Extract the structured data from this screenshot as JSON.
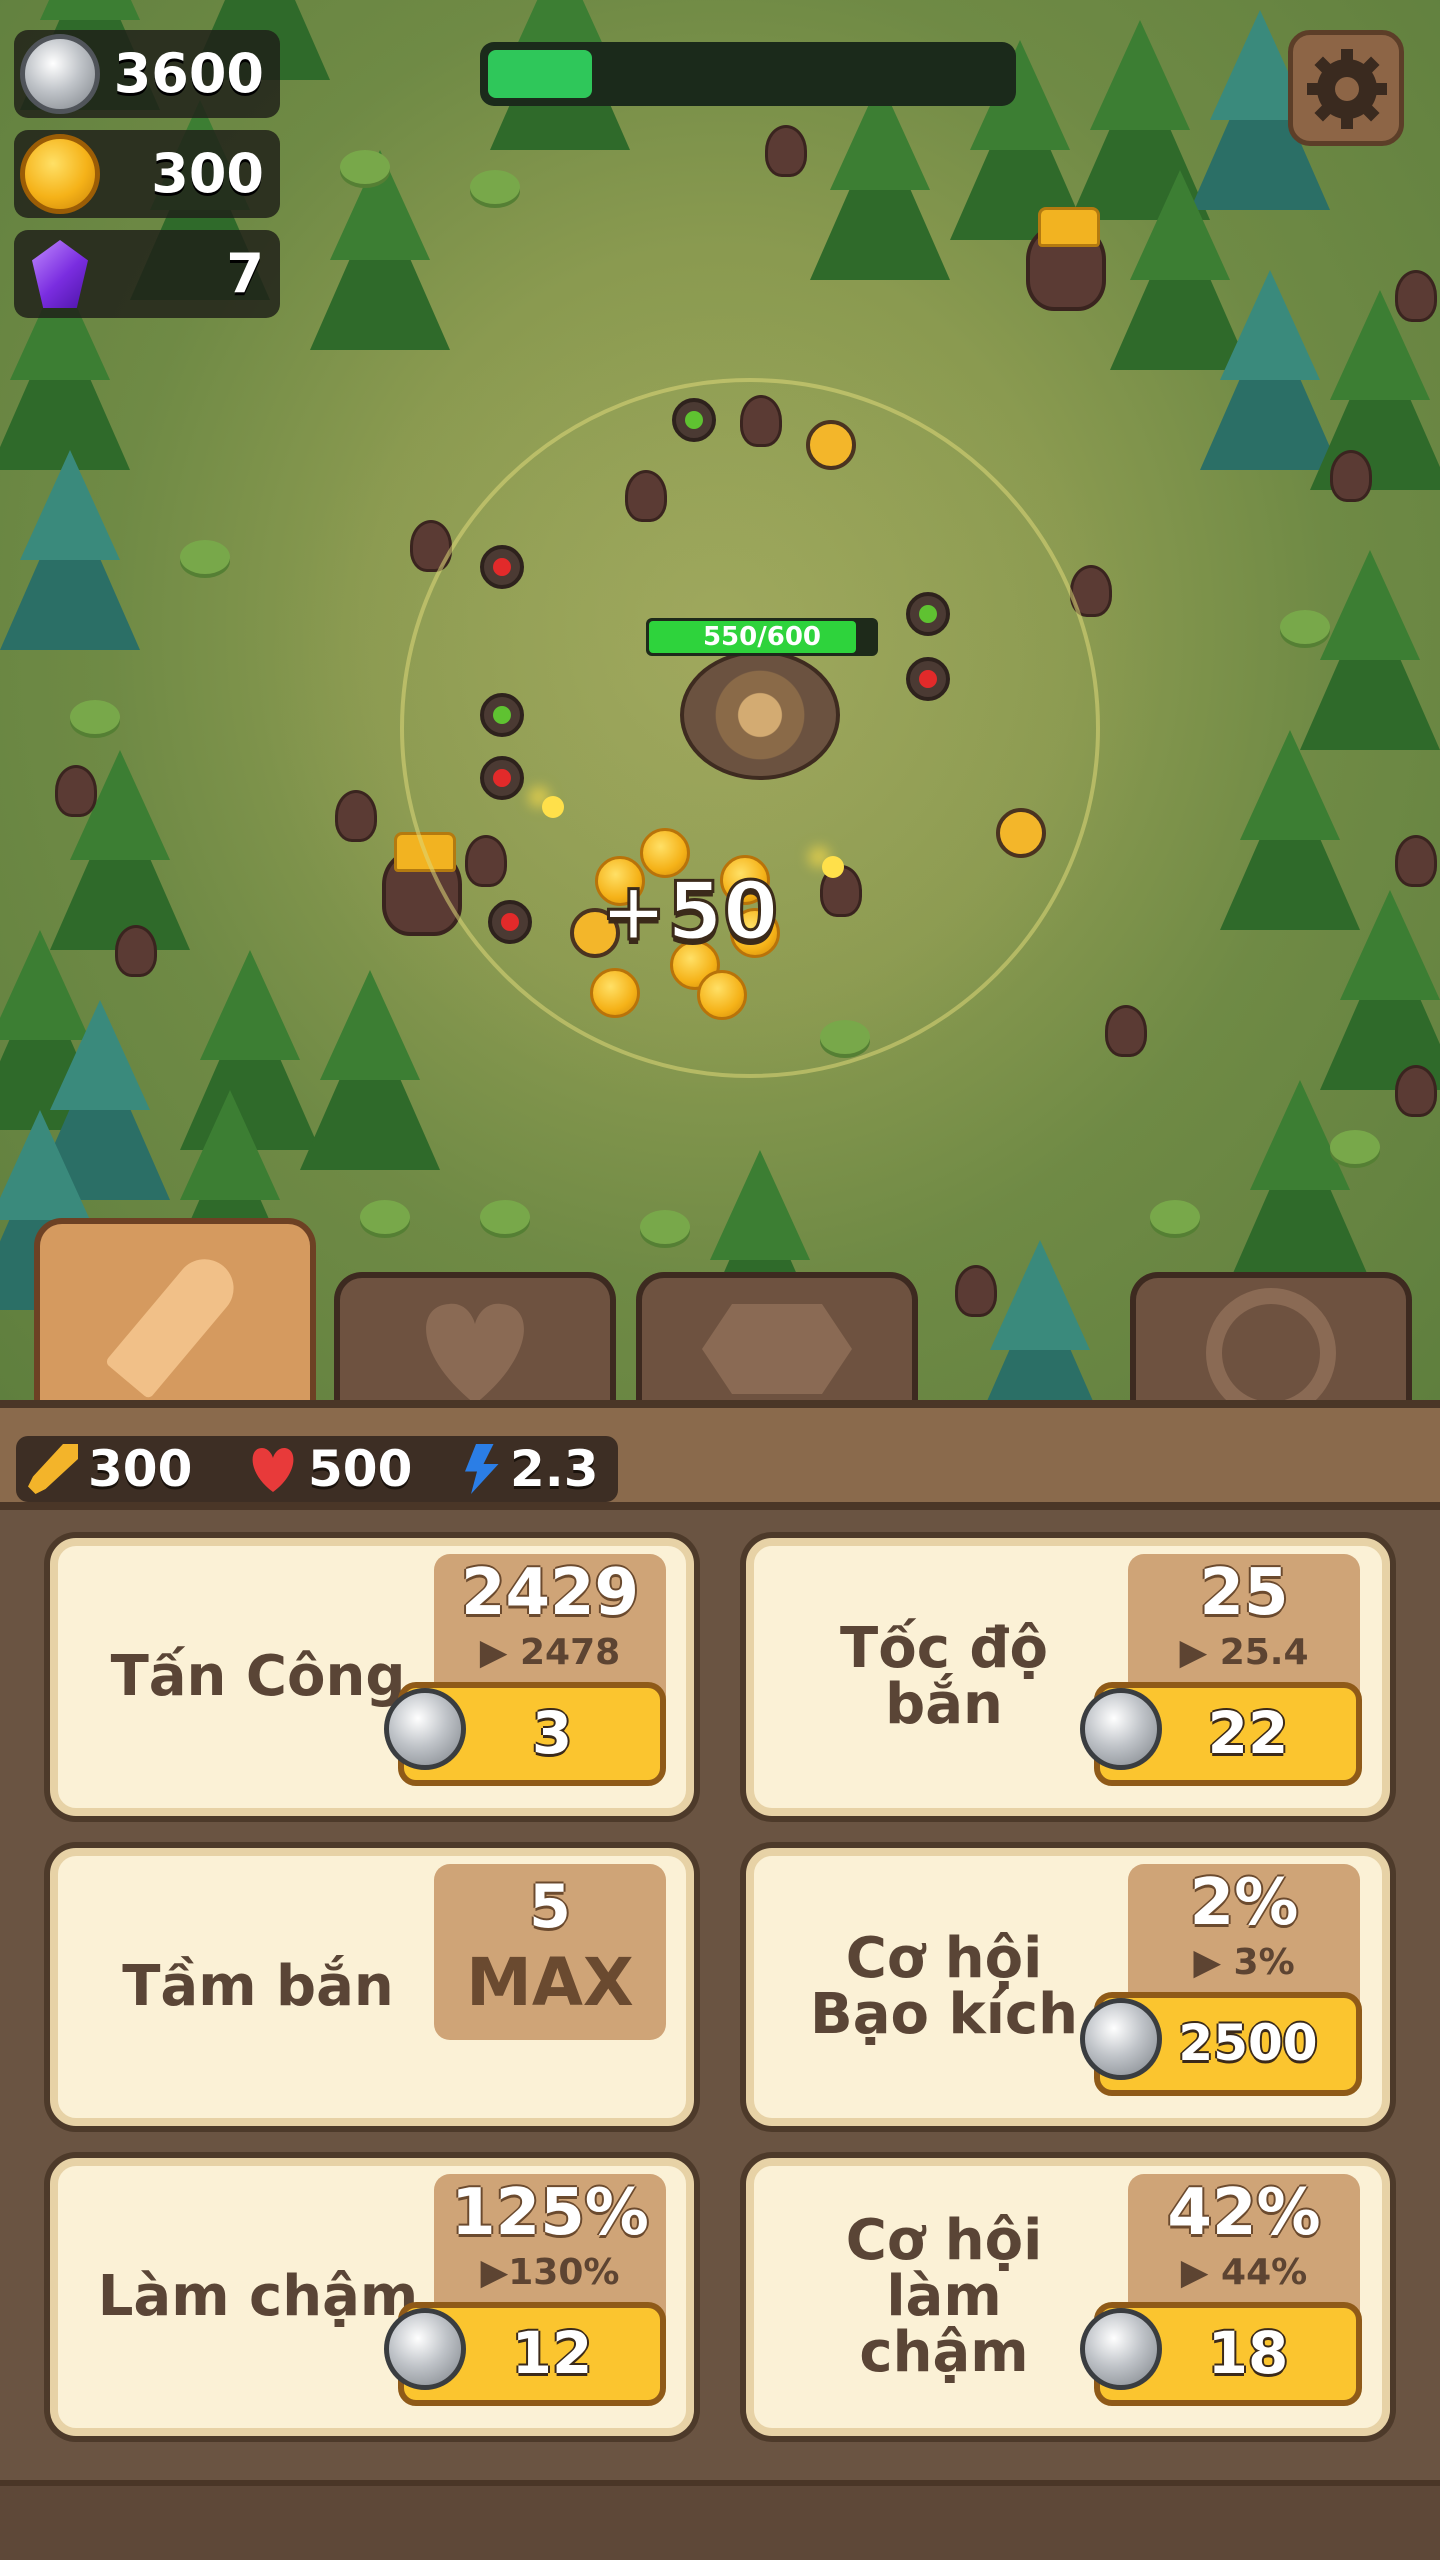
{
  "resources": {
    "silver": "3600",
    "gold": "300",
    "gems": "7"
  },
  "wave_progress": 0.2,
  "tower": {
    "hp_text": "550/600"
  },
  "floating_text": "+50",
  "tabs": [
    {
      "icon": "sword-icon",
      "active": true
    },
    {
      "icon": "heart-icon",
      "active": false
    },
    {
      "icon": "diamond-icon",
      "active": false
    },
    {
      "icon": "target-icon",
      "active": false
    }
  ],
  "stats": {
    "attack": "300",
    "health": "500",
    "speed": "2.3"
  },
  "upgrades": [
    {
      "label": "Tấn Công",
      "current": "2429",
      "next": "▶ 2478",
      "cost": "3"
    },
    {
      "label": "Tốc độ bắn",
      "current": "25",
      "next": "▶ 25.4",
      "cost": "22"
    },
    {
      "label": "Tầm bắn",
      "current": "5",
      "max_label": "MAX"
    },
    {
      "label": "Cơ hội Bạo kích",
      "current": "2%",
      "next": "▶ 3%",
      "cost": "2500"
    },
    {
      "label": "Làm chậm",
      "current": "125%",
      "next": "▶130%",
      "cost": "12"
    },
    {
      "label": "Cơ hội làm chậm",
      "current": "42%",
      "next": "▶ 44%",
      "cost": "18"
    }
  ],
  "colors": {
    "button_yellow": "#fbc52f",
    "card_bg": "#fbf1d6",
    "hp_green": "#2ed33c",
    "wave_green": "#2fc75a"
  }
}
